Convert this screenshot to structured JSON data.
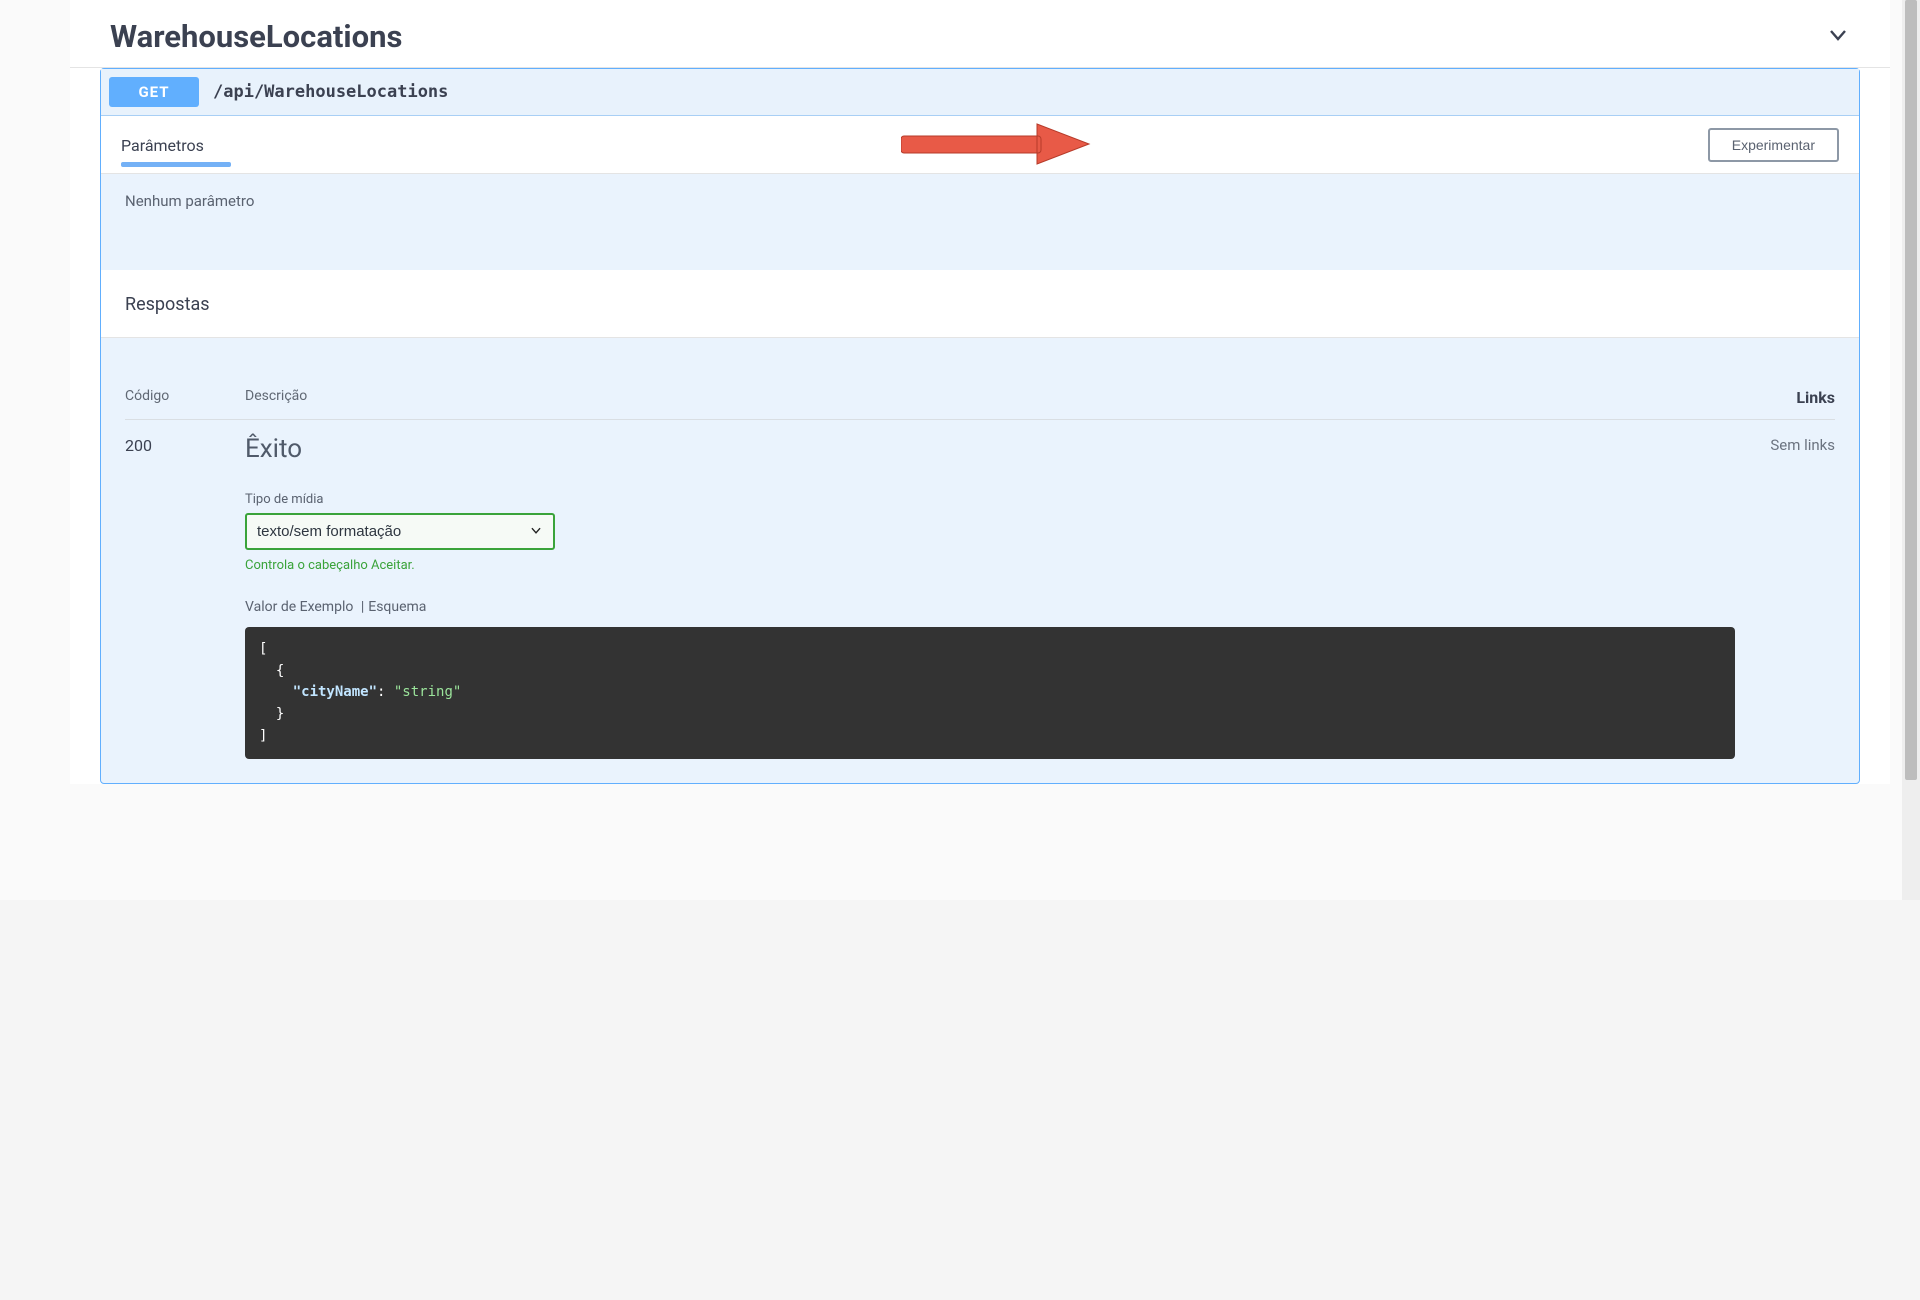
{
  "operation": {
    "title": "WarehouseLocations",
    "method": "GET",
    "path": "/api/WarehouseLocations"
  },
  "parameters": {
    "tab_label": "Parâmetros",
    "tryout_button": "Experimentar",
    "empty_text": "Nenhum parâmetro"
  },
  "responses": {
    "section_label": "Respostas",
    "headers": {
      "code": "Código",
      "description": "Descrição",
      "links": "Links"
    },
    "row": {
      "code": "200",
      "title": "Êxito",
      "links_text": "Sem links",
      "media_type_label": "Tipo de mídia",
      "media_type_value": "texto/sem formatação",
      "accept_note": "Controla o cabeçalho Aceitar.",
      "example_label": "Valor de Exemplo",
      "schema_label": "Esquema",
      "separator": " |",
      "example_key": "\"cityName\"",
      "example_val": "\"string\""
    }
  }
}
